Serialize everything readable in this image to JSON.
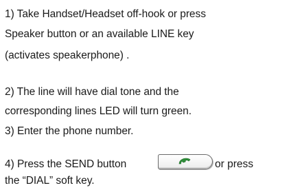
{
  "steps": {
    "s1_l1": "1) Take Handset/Headset off-hook or press",
    "s1_l2": "Speaker button or an available LINE key",
    "s1_l3": "(activates speakerphone) .",
    "s2_l1": "2) The line will have dial tone and the",
    "s2_l2": "corresponding lines  LED will turn green.",
    "s3": "3) Enter the phone number.",
    "s4_l1_before": "4) Press the SEND button",
    "s4_l1_after": "or press",
    "s4_l2": "the “DIAL” soft key."
  },
  "icons": {
    "send_button": "handset-icon",
    "handset_color": "#2f8f3a"
  }
}
